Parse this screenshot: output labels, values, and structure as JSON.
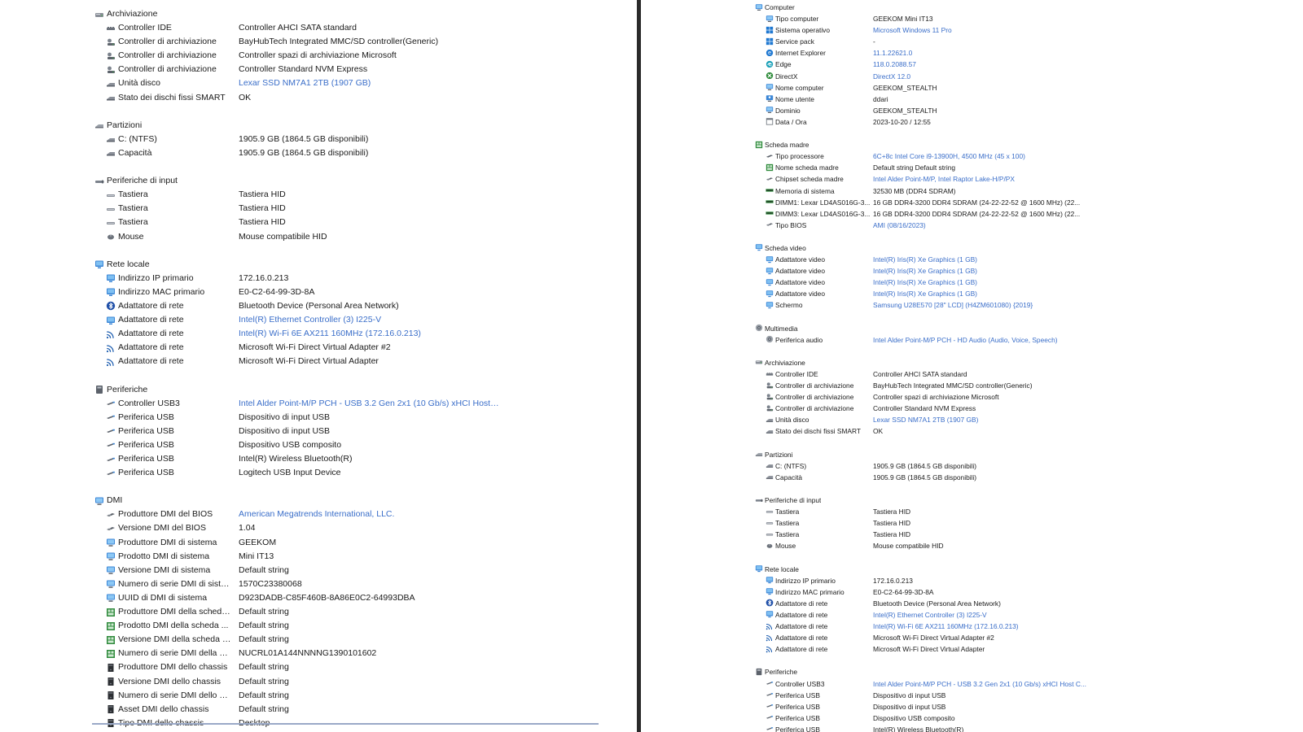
{
  "colors": {
    "link": "#3a6ec9",
    "text": "#1a1a1a",
    "divider": "#2b2b2b"
  },
  "left_panel": {
    "rows": [
      {
        "type": "section",
        "label": "Archiviazione",
        "icon": "drive-icon"
      },
      {
        "type": "item",
        "label": "Controller IDE",
        "value": "Controller AHCI SATA standard",
        "icon": "controller-icon"
      },
      {
        "type": "item",
        "label": "Controller di archiviazione",
        "value": "BayHubTech Integrated MMC/SD controller(Generic)",
        "icon": "storage-controller-icon"
      },
      {
        "type": "item",
        "label": "Controller di archiviazione",
        "value": "Controller spazi di archiviazione Microsoft",
        "icon": "storage-controller-icon"
      },
      {
        "type": "item",
        "label": "Controller di archiviazione",
        "value": "Controller Standard NVM Express",
        "icon": "storage-controller-icon"
      },
      {
        "type": "item",
        "label": "Unità disco",
        "value": "Lexar SSD NM7A1 2TB  (1907 GB)",
        "icon": "disk-icon",
        "link": true
      },
      {
        "type": "item",
        "label": "Stato dei dischi fissi SMART",
        "value": "OK",
        "icon": "disk-icon"
      },
      {
        "type": "blank"
      },
      {
        "type": "section",
        "label": "Partizioni",
        "icon": "partition-icon"
      },
      {
        "type": "item",
        "label": "C: (NTFS)",
        "value": "1905.9 GB (1864.5 GB disponibili)",
        "icon": "disk-icon"
      },
      {
        "type": "item",
        "label": "Capacità",
        "value": "1905.9 GB (1864.5 GB disponibili)",
        "icon": "disk-icon"
      },
      {
        "type": "blank"
      },
      {
        "type": "section",
        "label": "Periferiche di input",
        "icon": "input-devices-icon"
      },
      {
        "type": "item",
        "label": "Tastiera",
        "value": "Tastiera HID",
        "icon": "keyboard-icon"
      },
      {
        "type": "item",
        "label": "Tastiera",
        "value": "Tastiera HID",
        "icon": "keyboard-icon"
      },
      {
        "type": "item",
        "label": "Tastiera",
        "value": "Tastiera HID",
        "icon": "keyboard-icon"
      },
      {
        "type": "item",
        "label": "Mouse",
        "value": "Mouse compatibile HID",
        "icon": "mouse-icon"
      },
      {
        "type": "blank"
      },
      {
        "type": "section",
        "label": "Rete locale",
        "icon": "network-icon"
      },
      {
        "type": "item",
        "label": "Indirizzo IP primario",
        "value": "172.16.0.213",
        "icon": "network-icon"
      },
      {
        "type": "item",
        "label": "Indirizzo MAC primario",
        "value": "E0-C2-64-99-3D-8A",
        "icon": "network-icon"
      },
      {
        "type": "item",
        "label": "Adattatore di rete",
        "value": "Bluetooth Device (Personal Area Network)",
        "icon": "bluetooth-icon"
      },
      {
        "type": "item",
        "label": "Adattatore di rete",
        "value": "Intel(R) Ethernet Controller (3) I225-V",
        "icon": "network-icon",
        "link": true
      },
      {
        "type": "item",
        "label": "Adattatore di rete",
        "value": "Intel(R) Wi-Fi 6E AX211 160MHz  (172.16.0.213)",
        "icon": "wifi-icon",
        "link": true
      },
      {
        "type": "item",
        "label": "Adattatore di rete",
        "value": "Microsoft Wi-Fi Direct Virtual Adapter #2",
        "icon": "wifi-icon"
      },
      {
        "type": "item",
        "label": "Adattatore di rete",
        "value": "Microsoft Wi-Fi Direct Virtual Adapter",
        "icon": "wifi-icon"
      },
      {
        "type": "blank"
      },
      {
        "type": "section",
        "label": "Periferiche",
        "icon": "peripherals-icon"
      },
      {
        "type": "item",
        "label": "Controller USB3",
        "value": "Intel Alder Point-M/P PCH - USB 3.2 Gen 2x1 (10 Gb/s) xHCI Host C...",
        "icon": "usb-icon",
        "link": true
      },
      {
        "type": "item",
        "label": "Periferica USB",
        "value": "Dispositivo di input USB",
        "icon": "usb-icon"
      },
      {
        "type": "item",
        "label": "Periferica USB",
        "value": "Dispositivo di input USB",
        "icon": "usb-icon"
      },
      {
        "type": "item",
        "label": "Periferica USB",
        "value": "Dispositivo USB composito",
        "icon": "usb-icon"
      },
      {
        "type": "item",
        "label": "Periferica USB",
        "value": "Intel(R) Wireless Bluetooth(R)",
        "icon": "usb-icon"
      },
      {
        "type": "item",
        "label": "Periferica USB",
        "value": "Logitech USB Input Device",
        "icon": "usb-icon"
      },
      {
        "type": "blank"
      },
      {
        "type": "section",
        "label": "DMI",
        "icon": "computer-icon"
      },
      {
        "type": "item",
        "label": "Produttore DMI del BIOS",
        "value": "American Megatrends International, LLC.",
        "icon": "chip-icon",
        "link": true
      },
      {
        "type": "item",
        "label": "Versione DMI del BIOS",
        "value": "1.04",
        "icon": "chip-icon"
      },
      {
        "type": "item",
        "label": "Produttore DMI di sistema",
        "value": "GEEKOM",
        "icon": "computer-icon"
      },
      {
        "type": "item",
        "label": "Prodotto DMI di sistema",
        "value": "Mini IT13",
        "icon": "computer-icon"
      },
      {
        "type": "item",
        "label": "Versione DMI di sistema",
        "value": "Default string",
        "icon": "computer-icon"
      },
      {
        "type": "item",
        "label": "Numero di serie DMI di siste...",
        "value": "1570C23380068",
        "icon": "computer-icon"
      },
      {
        "type": "item",
        "label": "UUID di DMI di sistema",
        "value": "D923DADB-C85F460B-8A86E0C2-64993DBA",
        "icon": "computer-icon"
      },
      {
        "type": "item",
        "label": "Produttore DMI della scheda ...",
        "value": "Default string",
        "icon": "motherboard-icon"
      },
      {
        "type": "item",
        "label": "Prodotto DMI della scheda ...",
        "value": "Default string",
        "icon": "motherboard-icon"
      },
      {
        "type": "item",
        "label": "Versione DMI della scheda m...",
        "value": "Default string",
        "icon": "motherboard-icon"
      },
      {
        "type": "item",
        "label": "Numero di serie DMI della sc...",
        "value": "NUCRL01A144NNNNG1390101602",
        "icon": "motherboard-icon"
      },
      {
        "type": "item",
        "label": "Produttore DMI dello chassis",
        "value": "Default string",
        "icon": "chassis-icon"
      },
      {
        "type": "item",
        "label": "Versione DMI dello chassis",
        "value": "Default string",
        "icon": "chassis-icon"
      },
      {
        "type": "item",
        "label": "Numero di serie DMI dello ch...",
        "value": "Default string",
        "icon": "chassis-icon"
      },
      {
        "type": "item",
        "label": "Asset DMI dello chassis",
        "value": "Default string",
        "icon": "chassis-icon"
      },
      {
        "type": "item",
        "label": "Tipo DMI dello chassis",
        "value": "Desktop",
        "icon": "chassis-icon"
      }
    ]
  },
  "right_panel": {
    "rows": [
      {
        "type": "section",
        "label": "Computer",
        "icon": "computer-icon"
      },
      {
        "type": "item",
        "label": "Tipo computer",
        "value": "GEEKOM Mini IT13",
        "icon": "computer-icon"
      },
      {
        "type": "item",
        "label": "Sistema operativo",
        "value": "Microsoft Windows 11 Pro",
        "icon": "windows-icon",
        "link": true
      },
      {
        "type": "item",
        "label": "Service pack",
        "value": "-",
        "icon": "windows-icon"
      },
      {
        "type": "item",
        "label": "Internet Explorer",
        "value": "11.1.22621.0",
        "icon": "ie-icon",
        "link": true
      },
      {
        "type": "item",
        "label": "Edge",
        "value": "118.0.2088.57",
        "icon": "edge-icon",
        "link": true
      },
      {
        "type": "item",
        "label": "DirectX",
        "value": "DirectX 12.0",
        "icon": "directx-icon",
        "link": true
      },
      {
        "type": "item",
        "label": "Nome computer",
        "value": "GEEKOM_STEALTH",
        "icon": "computer-icon"
      },
      {
        "type": "item",
        "label": "Nome utente",
        "value": "ddari",
        "icon": "user-icon"
      },
      {
        "type": "item",
        "label": "Dominio",
        "value": "GEEKOM_STEALTH",
        "icon": "computer-icon"
      },
      {
        "type": "item",
        "label": "Data / Ora",
        "value": "2023-10-20 / 12:55",
        "icon": "calendar-icon"
      },
      {
        "type": "blank"
      },
      {
        "type": "section",
        "label": "Scheda madre",
        "icon": "motherboard-icon"
      },
      {
        "type": "item",
        "label": "Tipo processore",
        "value": "6C+8c Intel Core i9-13900H, 4500 MHz (45 x 100)",
        "icon": "cpu-icon",
        "link": true
      },
      {
        "type": "item",
        "label": "Nome scheda madre",
        "value": "Default string Default string",
        "icon": "motherboard-icon"
      },
      {
        "type": "item",
        "label": "Chipset scheda madre",
        "value": "Intel Alder Point-M/P, Intel Raptor Lake-H/P/PX",
        "icon": "chip-icon",
        "link": true
      },
      {
        "type": "item",
        "label": "Memoria di sistema",
        "value": "32530 MB  (DDR4 SDRAM)",
        "icon": "memory-icon"
      },
      {
        "type": "item",
        "label": "DIMM1: Lexar LD4AS016G-3...",
        "value": "16 GB DDR4-3200 DDR4 SDRAM  (24-22-22-52 @ 1600 MHz)  (22...",
        "icon": "memory-icon"
      },
      {
        "type": "item",
        "label": "DIMM3: Lexar LD4AS016G-3...",
        "value": "16 GB DDR4-3200 DDR4 SDRAM  (24-22-22-52 @ 1600 MHz)  (22...",
        "icon": "memory-icon"
      },
      {
        "type": "item",
        "label": "Tipo BIOS",
        "value": "AMI (08/16/2023)",
        "icon": "chip-icon",
        "link": true
      },
      {
        "type": "blank"
      },
      {
        "type": "section",
        "label": "Scheda video",
        "icon": "display-icon"
      },
      {
        "type": "item",
        "label": "Adattatore video",
        "value": "Intel(R) Iris(R) Xe Graphics  (1 GB)",
        "icon": "display-icon",
        "link": true
      },
      {
        "type": "item",
        "label": "Adattatore video",
        "value": "Intel(R) Iris(R) Xe Graphics  (1 GB)",
        "icon": "display-icon",
        "link": true
      },
      {
        "type": "item",
        "label": "Adattatore video",
        "value": "Intel(R) Iris(R) Xe Graphics  (1 GB)",
        "icon": "display-icon",
        "link": true
      },
      {
        "type": "item",
        "label": "Adattatore video",
        "value": "Intel(R) Iris(R) Xe Graphics  (1 GB)",
        "icon": "display-icon",
        "link": true
      },
      {
        "type": "item",
        "label": "Schermo",
        "value": "Samsung U28E570  [28\" LCD]  (H4ZM601080)  {2019}",
        "icon": "display-icon",
        "link": true
      },
      {
        "type": "blank"
      },
      {
        "type": "section",
        "label": "Multimedia",
        "icon": "speaker-icon"
      },
      {
        "type": "item",
        "label": "Periferica audio",
        "value": "Intel Alder Point-M/P PCH - HD Audio (Audio, Voice, Speech)",
        "icon": "speaker-icon",
        "link": true
      },
      {
        "type": "blank"
      },
      {
        "type": "section",
        "label": "Archiviazione",
        "icon": "drive-icon"
      },
      {
        "type": "item",
        "label": "Controller IDE",
        "value": "Controller AHCI SATA standard",
        "icon": "controller-icon"
      },
      {
        "type": "item",
        "label": "Controller di archiviazione",
        "value": "BayHubTech Integrated MMC/SD controller(Generic)",
        "icon": "storage-controller-icon"
      },
      {
        "type": "item",
        "label": "Controller di archiviazione",
        "value": "Controller spazi di archiviazione Microsoft",
        "icon": "storage-controller-icon"
      },
      {
        "type": "item",
        "label": "Controller di archiviazione",
        "value": "Controller Standard NVM Express",
        "icon": "storage-controller-icon"
      },
      {
        "type": "item",
        "label": "Unità disco",
        "value": "Lexar SSD NM7A1 2TB  (1907 GB)",
        "icon": "disk-icon",
        "link": true
      },
      {
        "type": "item",
        "label": "Stato dei dischi fissi SMART",
        "value": "OK",
        "icon": "disk-icon"
      },
      {
        "type": "blank"
      },
      {
        "type": "section",
        "label": "Partizioni",
        "icon": "partition-icon"
      },
      {
        "type": "item",
        "label": "C: (NTFS)",
        "value": "1905.9 GB (1864.5 GB disponibili)",
        "icon": "disk-icon"
      },
      {
        "type": "item",
        "label": "Capacità",
        "value": "1905.9 GB (1864.5 GB disponibili)",
        "icon": "disk-icon"
      },
      {
        "type": "blank"
      },
      {
        "type": "section",
        "label": "Periferiche di input",
        "icon": "input-devices-icon"
      },
      {
        "type": "item",
        "label": "Tastiera",
        "value": "Tastiera HID",
        "icon": "keyboard-icon"
      },
      {
        "type": "item",
        "label": "Tastiera",
        "value": "Tastiera HID",
        "icon": "keyboard-icon"
      },
      {
        "type": "item",
        "label": "Tastiera",
        "value": "Tastiera HID",
        "icon": "keyboard-icon"
      },
      {
        "type": "item",
        "label": "Mouse",
        "value": "Mouse compatibile HID",
        "icon": "mouse-icon"
      },
      {
        "type": "blank"
      },
      {
        "type": "section",
        "label": "Rete locale",
        "icon": "network-icon"
      },
      {
        "type": "item",
        "label": "Indirizzo IP primario",
        "value": "172.16.0.213",
        "icon": "network-icon"
      },
      {
        "type": "item",
        "label": "Indirizzo MAC primario",
        "value": "E0-C2-64-99-3D-8A",
        "icon": "network-icon"
      },
      {
        "type": "item",
        "label": "Adattatore di rete",
        "value": "Bluetooth Device (Personal Area Network)",
        "icon": "bluetooth-icon"
      },
      {
        "type": "item",
        "label": "Adattatore di rete",
        "value": "Intel(R) Ethernet Controller (3) I225-V",
        "icon": "network-icon",
        "link": true
      },
      {
        "type": "item",
        "label": "Adattatore di rete",
        "value": "Intel(R) Wi-Fi 6E AX211 160MHz  (172.16.0.213)",
        "icon": "wifi-icon",
        "link": true
      },
      {
        "type": "item",
        "label": "Adattatore di rete",
        "value": "Microsoft Wi-Fi Direct Virtual Adapter #2",
        "icon": "wifi-icon"
      },
      {
        "type": "item",
        "label": "Adattatore di rete",
        "value": "Microsoft Wi-Fi Direct Virtual Adapter",
        "icon": "wifi-icon"
      },
      {
        "type": "blank"
      },
      {
        "type": "section",
        "label": "Periferiche",
        "icon": "peripherals-icon"
      },
      {
        "type": "item",
        "label": "Controller USB3",
        "value": "Intel Alder Point-M/P PCH - USB 3.2 Gen 2x1 (10 Gb/s) xHCI Host C...",
        "icon": "usb-icon",
        "link": true
      },
      {
        "type": "item",
        "label": "Periferica USB",
        "value": "Dispositivo di input USB",
        "icon": "usb-icon"
      },
      {
        "type": "item",
        "label": "Periferica USB",
        "value": "Dispositivo di input USB",
        "icon": "usb-icon"
      },
      {
        "type": "item",
        "label": "Periferica USB",
        "value": "Dispositivo USB composito",
        "icon": "usb-icon"
      },
      {
        "type": "item",
        "label": "Periferica USB",
        "value": "Intel(R) Wireless Bluetooth(R)",
        "icon": "usb-icon"
      }
    ]
  }
}
